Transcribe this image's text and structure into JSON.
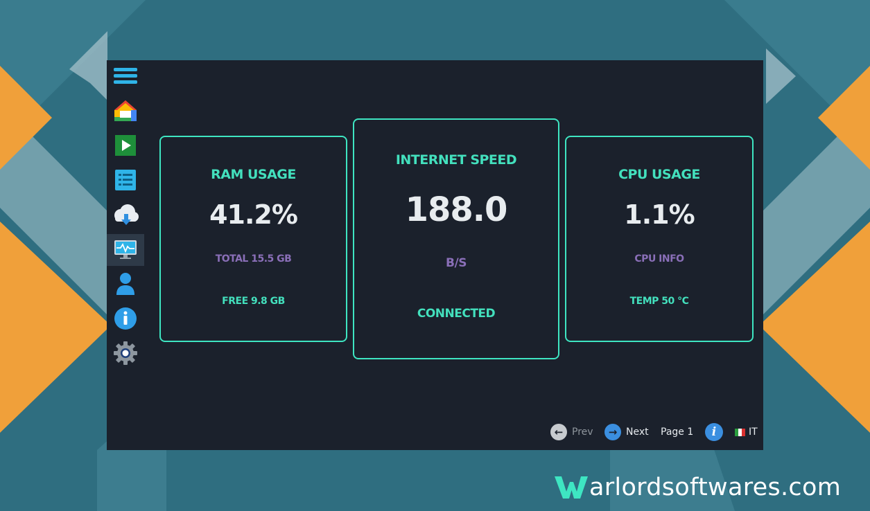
{
  "sidebar": {
    "items": [
      {
        "name": "menu",
        "icon": "hamburger-menu-icon"
      },
      {
        "name": "home",
        "icon": "home-icon"
      },
      {
        "name": "play",
        "icon": "play-icon"
      },
      {
        "name": "list",
        "icon": "list-icon"
      },
      {
        "name": "cloud-download",
        "icon": "cloud-download-icon"
      },
      {
        "name": "monitor",
        "icon": "monitor-activity-icon",
        "active": true
      },
      {
        "name": "user",
        "icon": "user-icon"
      },
      {
        "name": "info",
        "icon": "info-icon"
      },
      {
        "name": "settings",
        "icon": "gear-icon"
      }
    ]
  },
  "cards": {
    "ram": {
      "title": "RAM USAGE",
      "value": "41.2%",
      "sub": "TOTAL 15.5 GB",
      "foot": "FREE 9.8 GB"
    },
    "internet": {
      "title": "INTERNET SPEED",
      "value": "188.0",
      "sub": "B/S",
      "foot": "CONNECTED"
    },
    "cpu": {
      "title": "CPU USAGE",
      "value": "1.1%",
      "sub": "CPU INFO",
      "foot": "TEMP 50 °C"
    }
  },
  "footer": {
    "prev_label": "Prev",
    "next_label": "Next",
    "page_label": "Page 1",
    "language_label": "IT"
  },
  "watermark": {
    "text": "arlordsoftwares.com"
  },
  "colors": {
    "accent": "#3ee6c2",
    "panel_bg": "#1b212c",
    "sub_text": "#8a6fb8",
    "background": "#2f6e80",
    "orange": "#f0a03a"
  }
}
